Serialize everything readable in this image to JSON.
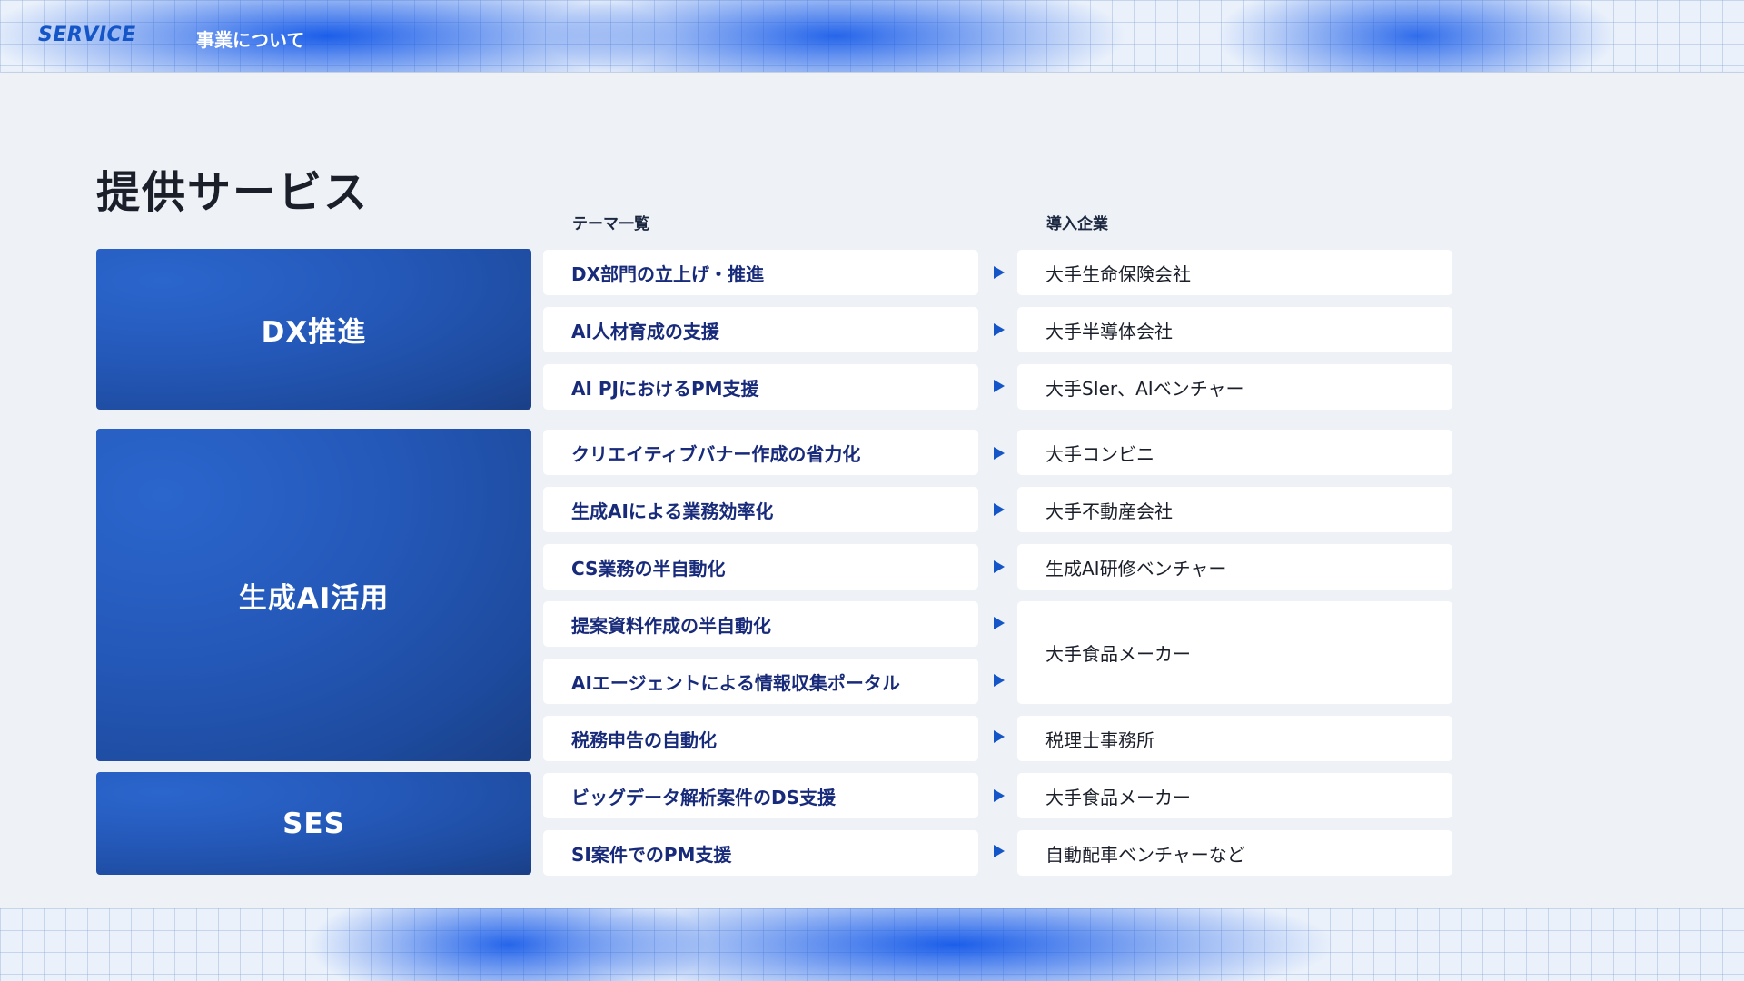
{
  "header": {
    "brand": "SERVICE",
    "section": "事業について"
  },
  "page_title": "提供サービス",
  "columns": {
    "theme": "テーマ一覧",
    "company": "導入企業"
  },
  "categories": [
    {
      "label": "DX推進"
    },
    {
      "label": "生成AI活用"
    },
    {
      "label": "SES"
    }
  ],
  "themes": [
    "DX部門の立上げ・推進",
    "AI人材育成の支援",
    "AI PJにおけるPM支援",
    "クリエイティブバナー作成の省力化",
    "生成AIによる業務効率化",
    "CS業務の半自動化",
    "提案資料作成の半自動化",
    "AIエージェントによる情報収集ポータル",
    "税務申告の自動化",
    "ビッグデータ解析案件のDS支援",
    "SI案件でのPM支援"
  ],
  "companies": [
    "大手生命保険会社",
    "大手半導体会社",
    "大手SIer、AIベンチャー",
    "大手コンビニ",
    "大手不動産会社",
    "生成AI研修ベンチャー",
    "大手食品メーカー",
    "税理士事務所",
    "大手食品メーカー",
    "自動配車ベンチャーなど"
  ],
  "colors": {
    "accent": "#1456c8",
    "category_bg": "#2458b8",
    "theme_text": "#182a7a",
    "page_bg": "#eef2f6"
  },
  "icons": {
    "arrow": "triangle-right-icon"
  }
}
